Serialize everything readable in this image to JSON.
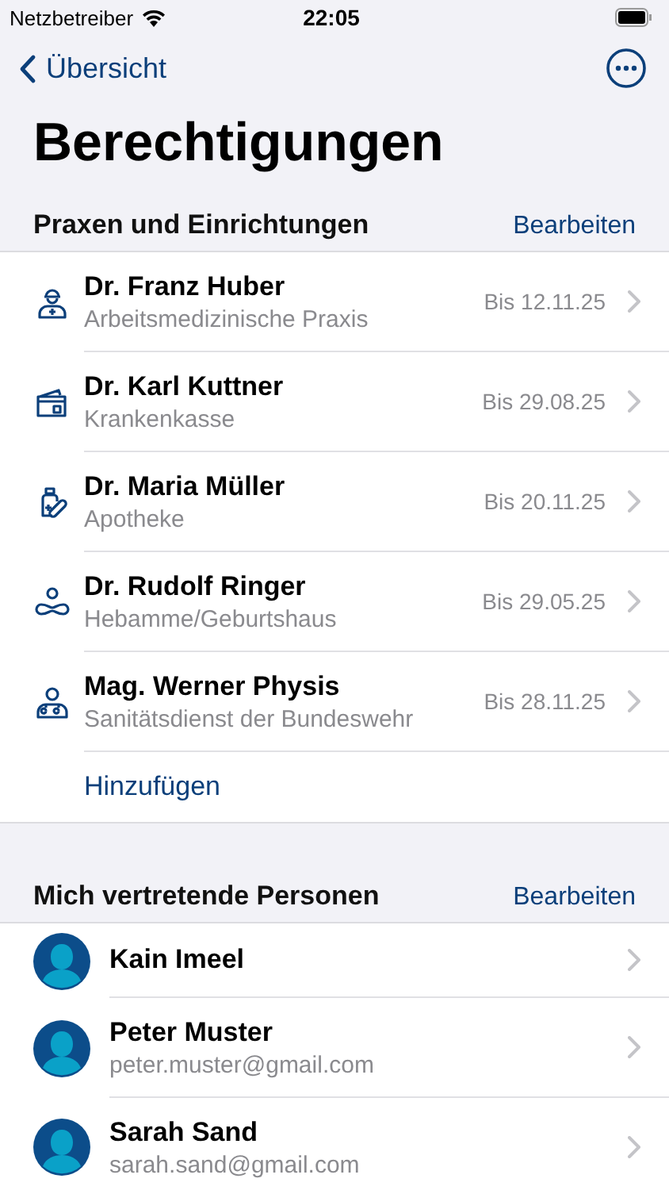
{
  "status_bar": {
    "carrier": "Netzbetreiber",
    "time": "22:05"
  },
  "nav": {
    "back": "Übersicht"
  },
  "title": "Berechtigungen",
  "sections": [
    {
      "header": "Praxen und Einrichtungen",
      "action": "Bearbeiten",
      "kind": "provider",
      "items": [
        {
          "kind": "helmet",
          "name": "Dr. Franz Huber",
          "subtitle": "Arbeitsmedizinische Praxis",
          "until": "Bis 12.11.25"
        },
        {
          "kind": "card",
          "name": "Dr. Karl Kuttner",
          "subtitle": "Krankenkasse",
          "until": "Bis 29.08.25"
        },
        {
          "kind": "pharmacy",
          "name": "Dr. Maria Müller",
          "subtitle": "Apotheke",
          "until": "Bis 20.11.25"
        },
        {
          "kind": "midwife",
          "name": "Dr. Rudolf Ringer",
          "subtitle": "Hebamme/Geburtshaus",
          "until": "Bis 29.05.25"
        },
        {
          "kind": "medic",
          "name": "Mag. Werner Physis",
          "subtitle": "Sanitätsdienst der Bundeswehr",
          "until": "Bis 28.11.25"
        }
      ],
      "add": "Hinzufügen"
    },
    {
      "header": "Mich vertretende Personen",
      "action": "Bearbeiten",
      "kind": "person",
      "items": [
        {
          "name": "Kain Imeel"
        },
        {
          "name": "Peter Muster",
          "subtitle": "peter.muster@gmail.com"
        },
        {
          "name": "Sarah Sand",
          "subtitle": "sarah.sand@gmail.com"
        }
      ]
    }
  ]
}
